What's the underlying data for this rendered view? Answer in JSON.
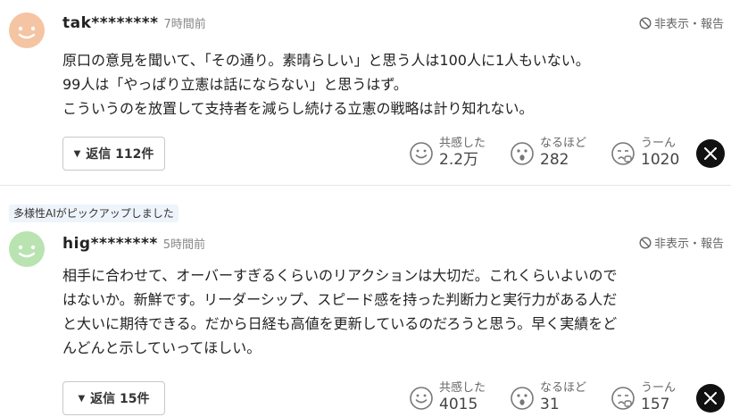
{
  "comments": [
    {
      "username": "tak********",
      "time": "7時間前",
      "report": "非表示・報告",
      "lines": [
        "原口の意見を聞いて、「その通り。素晴らしい」と思う人は100人に1人もいない。",
        "99人は「やっぱり立憲は話にならない」と思うはず。",
        "こういうのを放置して支持者を減らし続ける立憲の戦略は計り知れない。"
      ],
      "reply": "返信 112件",
      "reactions": [
        {
          "label": "共感した",
          "count": "2.2万",
          "icon": "smile-face-icon"
        },
        {
          "label": "なるほど",
          "count": "282",
          "icon": "surprised-face-icon"
        },
        {
          "label": "うーん",
          "count": "1020",
          "icon": "thinking-face-icon"
        }
      ],
      "avatar_color": "#f4c4a3"
    },
    {
      "badge": "多様性AIがピックアップしました",
      "username": "hig********",
      "time": "5時間前",
      "report": "非表示・報告",
      "lines": [
        "相手に合わせて、オーバーすぎるくらいのリアクションは大切だ。これくらいよいので",
        "はないか。新鮮です。リーダーシップ、スピード感を持った判断力と実行力がある人だ",
        "と大いに期待できる。だから日経も高値を更新しているのだろうと思う。早く実績をど",
        "んどんと示していってほしい。"
      ],
      "reply": "返信 15件",
      "reactions": [
        {
          "label": "共感した",
          "count": "4015",
          "icon": "smile-face-icon"
        },
        {
          "label": "なるほど",
          "count": "31",
          "icon": "surprised-face-icon"
        },
        {
          "label": "うーん",
          "count": "157",
          "icon": "thinking-face-icon"
        }
      ],
      "avatar_color": "#b9e3b1"
    }
  ],
  "share_icon": "x-logo-icon"
}
